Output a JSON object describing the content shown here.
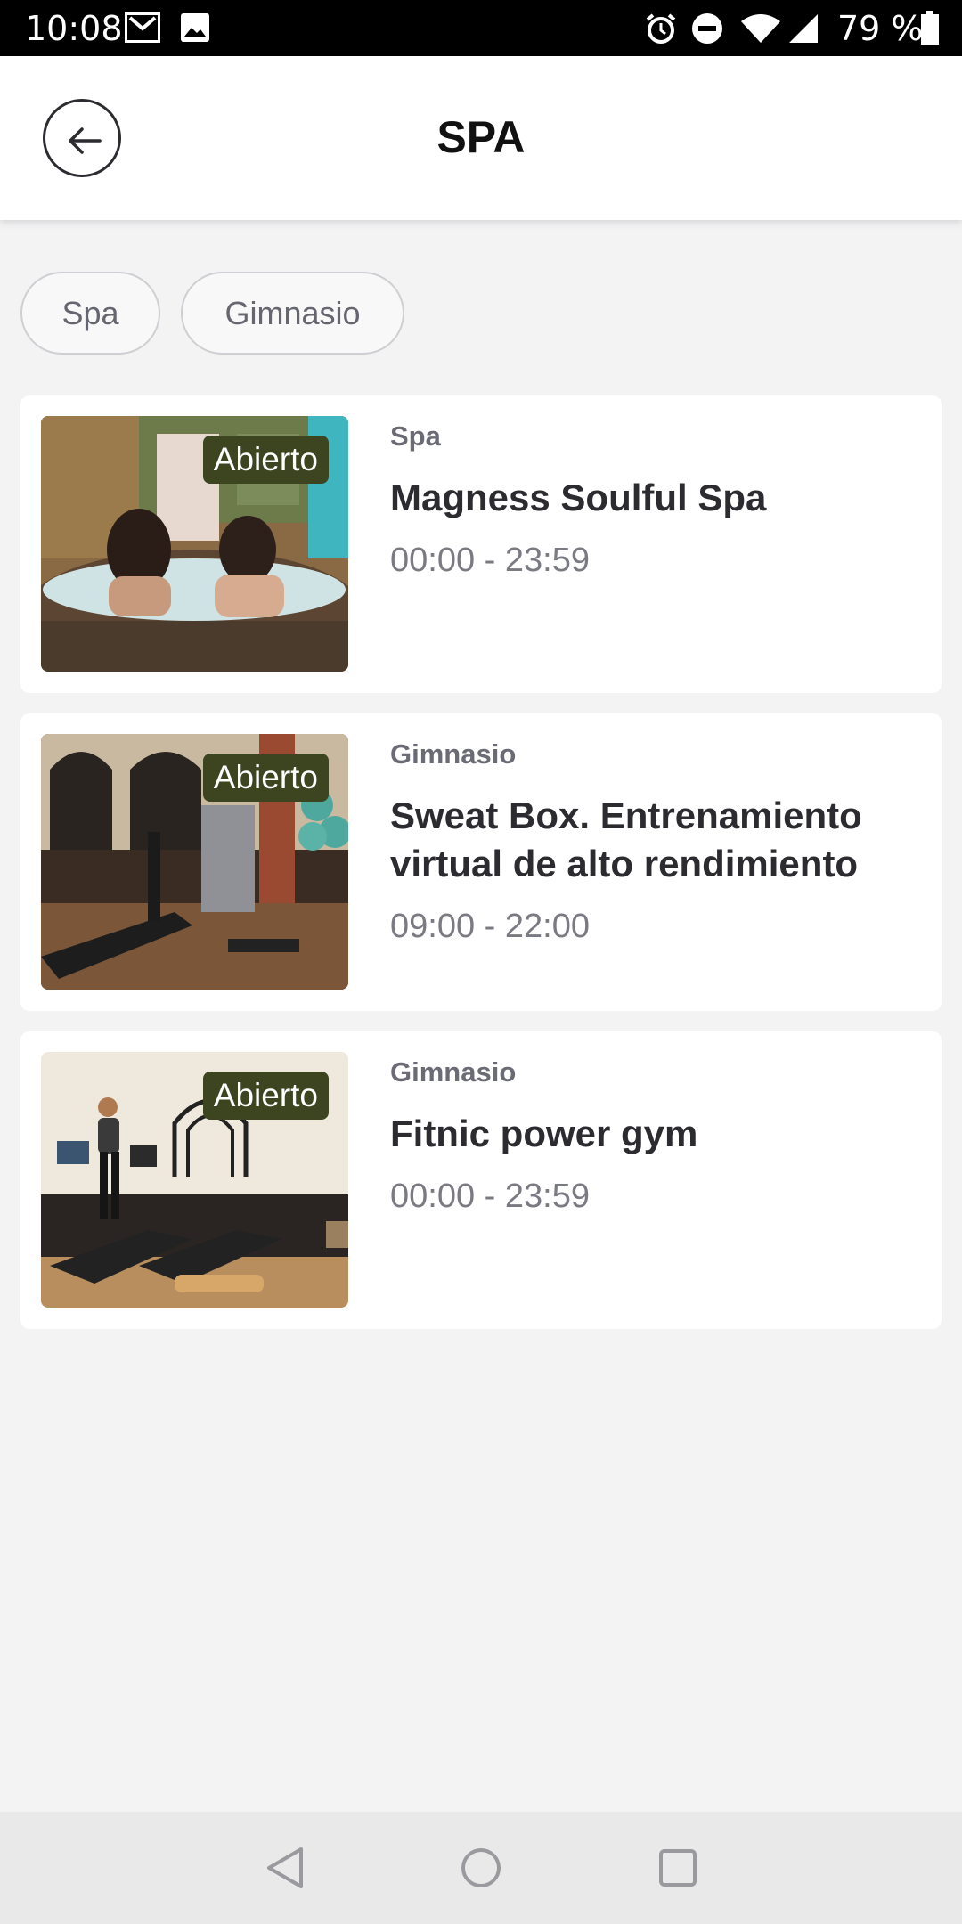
{
  "status": {
    "time": "10:08",
    "battery": "79 %"
  },
  "header": {
    "title": "SPA"
  },
  "filters": [
    {
      "label": "Spa"
    },
    {
      "label": "Gimnasio"
    }
  ],
  "cards": [
    {
      "category": "Spa",
      "name": "Magness Soulful Spa",
      "hours": "00:00 - 23:59",
      "badge": "Abierto"
    },
    {
      "category": "Gimnasio",
      "name": "Sweat Box. Entrenamiento virtual de alto rendimiento",
      "hours": "09:00 - 22:00",
      "badge": "Abierto"
    },
    {
      "category": "Gimnasio",
      "name": "Fitnic power gym",
      "hours": "00:00 - 23:59",
      "badge": "Abierto"
    }
  ],
  "colors": {
    "badge_bg": "#3c4420",
    "background": "#f3f3f4",
    "card": "#ffffff"
  },
  "icons": [
    "gmail-icon",
    "image-icon",
    "alarm-icon",
    "do-not-disturb-icon",
    "wifi-icon",
    "signal-icon",
    "battery-icon",
    "back-arrow-icon",
    "nav-back-icon",
    "nav-home-icon",
    "nav-recents-icon"
  ]
}
